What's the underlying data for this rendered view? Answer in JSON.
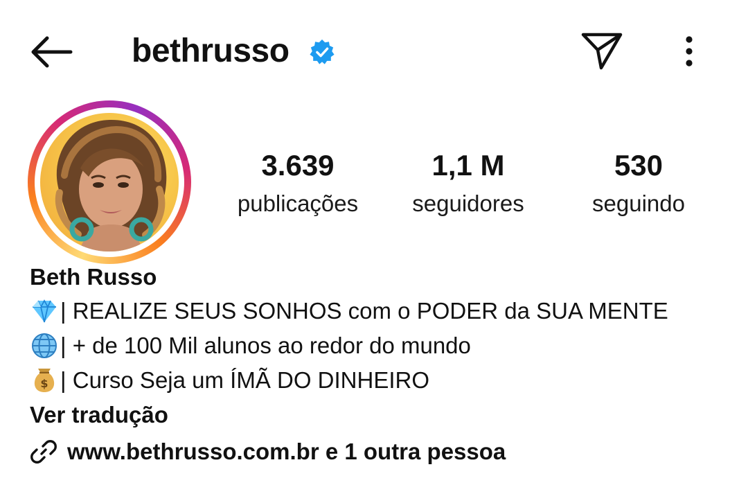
{
  "header": {
    "username": "bethrusso",
    "back_icon": "arrow-left-icon",
    "verified_icon": "verified-badge-icon",
    "send_icon": "paper-plane-icon",
    "more_icon": "vertical-dots-icon"
  },
  "stats": {
    "posts": {
      "value": "3.639",
      "label": "publicações"
    },
    "followers": {
      "value": "1,1 M",
      "label": "seguidores"
    },
    "following": {
      "value": "530",
      "label": "seguindo"
    }
  },
  "bio": {
    "name": "Beth Russo",
    "lines": [
      {
        "icon": "gem-icon",
        "text": "| REALIZE SEUS SONHOS com o PODER da SUA MENTE"
      },
      {
        "icon": "globe-icon",
        "text": "| + de 100 Mil alunos ao redor do mundo"
      },
      {
        "icon": "money-bag-icon",
        "text": "| Curso Seja um ÍMÃ DO DINHEIRO"
      }
    ],
    "translate_label": "Ver tradução",
    "link_icon": "link-icon",
    "link_text": "www.bethrusso.com.br e 1 outra pessoa"
  },
  "colors": {
    "verified": "#1d9bf0",
    "text": "#111111",
    "story_ring": [
      "#feda75",
      "#fa7e1e",
      "#d62976",
      "#962fbf"
    ]
  }
}
